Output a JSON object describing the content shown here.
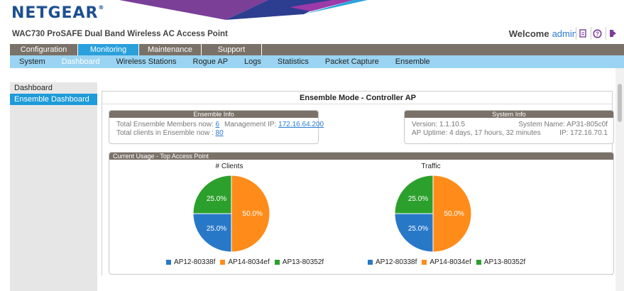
{
  "header": {
    "logo": "NETGEAR",
    "logo_mark": "®",
    "product": "WAC730 ProSAFE Dual Band Wireless AC Access Point",
    "welcome": "Welcome",
    "user": "admin"
  },
  "tabs": [
    {
      "label": "Configuration",
      "active": false
    },
    {
      "label": "Monitoring",
      "active": true
    },
    {
      "label": "Maintenance",
      "active": false
    },
    {
      "label": "Support",
      "active": false
    }
  ],
  "subtabs": [
    {
      "label": "System",
      "active": false
    },
    {
      "label": "Dashboard",
      "active": true
    },
    {
      "label": "Wireless Stations",
      "active": false
    },
    {
      "label": "Rogue AP",
      "active": false
    },
    {
      "label": "Logs",
      "active": false
    },
    {
      "label": "Statistics",
      "active": false
    },
    {
      "label": "Packet Capture",
      "active": false
    },
    {
      "label": "Ensemble",
      "active": false
    }
  ],
  "sidebar": {
    "items": [
      {
        "label": "Dashboard",
        "active": false
      },
      {
        "label": "Ensemble Dashboard",
        "active": true
      }
    ]
  },
  "main": {
    "title": "Ensemble Mode - Controller AP",
    "ensemble_info": {
      "header": "Ensemble Info",
      "members_label": "Total Ensemble Members now:",
      "members_value": "6",
      "clients_label": "Total clients in Ensemble now :",
      "clients_value": "80",
      "mgmt_ip_label": "Management IP:",
      "mgmt_ip_value": "172.16.64.200"
    },
    "system_info": {
      "header": "System Info",
      "version": "Version: 1.1.10.5",
      "system_name": "System Name: AP31-805c0f",
      "uptime": "AP Uptime: 4 days, 17 hours, 32 minutes",
      "ip": "IP: 172.16.70.1"
    },
    "usage": {
      "header": "Current Usage - Top Access Point"
    }
  },
  "chart_data": [
    {
      "type": "pie",
      "title": "# Clients",
      "categories": [
        "AP12-80338f",
        "AP14-8034ef",
        "AP13-80352f"
      ],
      "values": [
        25.0,
        50.0,
        25.0
      ],
      "labels": [
        "25.0%",
        "50.0%",
        "25.0%"
      ],
      "colors": [
        "#2878c8",
        "#ff8c1a",
        "#2ca02c"
      ],
      "legend": "bottom"
    },
    {
      "type": "pie",
      "title": "Traffic",
      "categories": [
        "AP12-80338f",
        "AP14-8034ef",
        "AP13-80352f"
      ],
      "values": [
        25.0,
        50.0,
        25.0
      ],
      "labels": [
        "25.0%",
        "50.0%",
        "25.0%"
      ],
      "colors": [
        "#2878c8",
        "#ff8c1a",
        "#2ca02c"
      ],
      "legend": "bottom"
    }
  ],
  "icons": {
    "header": [
      "document-icon",
      "help-icon",
      "logout-icon"
    ]
  },
  "colors": {
    "brand": "#1d4f91",
    "tab_bar": "#7a7168",
    "tab_active": "#2aa0dc",
    "subtab_bar": "#9ad4f2",
    "sidebar_active": "#1e9bd8",
    "link": "#2a7bd1"
  }
}
